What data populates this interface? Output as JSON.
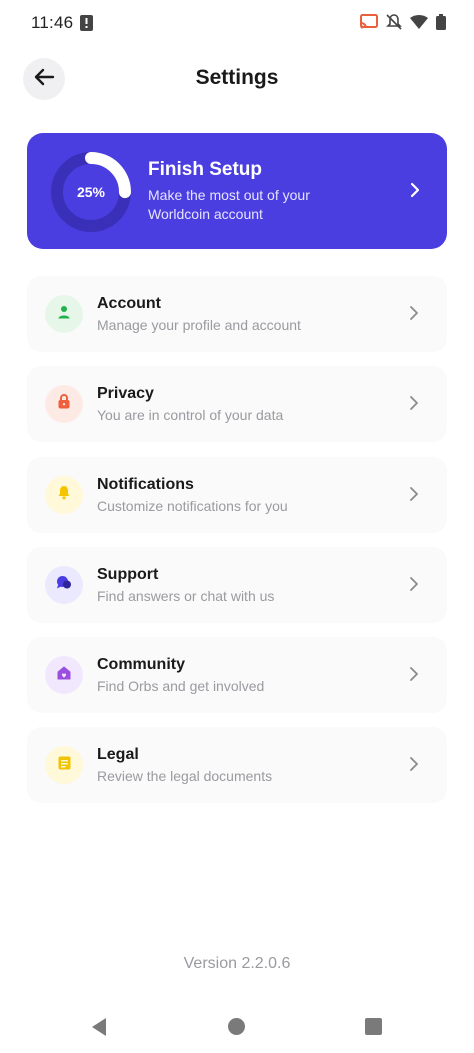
{
  "status_bar": {
    "time": "11:46"
  },
  "header": {
    "title": "Settings"
  },
  "setup_card": {
    "progress_label": "25%",
    "progress_fraction": 0.25,
    "title": "Finish Setup",
    "subtitle": "Make the most out of your Worldcoin account"
  },
  "menu": {
    "items": [
      {
        "label": "Account",
        "description": "Manage your profile and account",
        "icon": "person-icon",
        "icon_color": "#22b14c",
        "icon_bg": "#e6f7ea"
      },
      {
        "label": "Privacy",
        "description": "You are in control of your data",
        "icon": "lock-icon",
        "icon_color": "#ef5f3c",
        "icon_bg": "#fdeae5"
      },
      {
        "label": "Notifications",
        "description": "Customize notifications for you",
        "icon": "bell-icon",
        "icon_color": "#f5c400",
        "icon_bg": "#fff8d9"
      },
      {
        "label": "Support",
        "description": "Find answers or chat with us",
        "icon": "chat-icon",
        "icon_color": "#4b3ee0",
        "icon_bg": "#ebe9fd"
      },
      {
        "label": "Community",
        "description": "Find Orbs and get involved",
        "icon": "home-icon",
        "icon_color": "#9b4fe0",
        "icon_bg": "#f2e8fd"
      },
      {
        "label": "Legal",
        "description": "Review the legal documents",
        "icon": "document-icon",
        "icon_color": "#f0c400",
        "icon_bg": "#fff8d9"
      }
    ]
  },
  "footer": {
    "version": "Version 2.2.0.6"
  },
  "colors": {
    "accent": "#4b3ee0",
    "card_bg": "#fafafa",
    "muted_text": "#9a9aa0"
  }
}
